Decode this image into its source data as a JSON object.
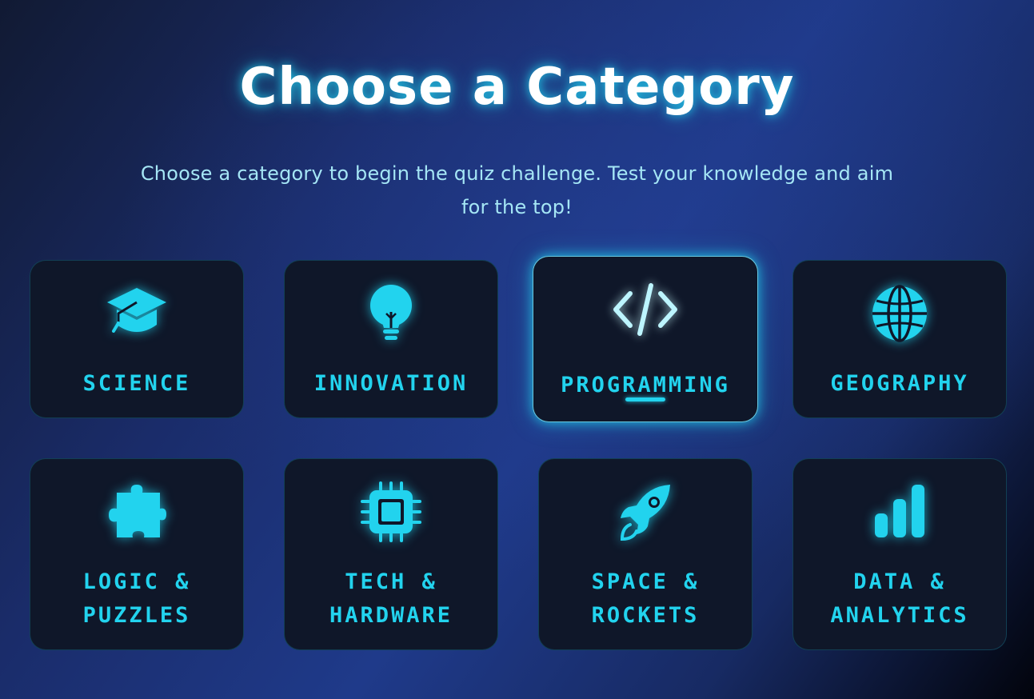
{
  "header": {
    "title": "Choose a Category",
    "subtitle": "Choose a category to begin the quiz challenge. Test your knowledge and aim for the top!"
  },
  "colors": {
    "accent": "#22d3ee",
    "card_bg": "#0f1729",
    "title": "#ffffff",
    "subtitle": "#a5e6f5"
  },
  "categories": [
    {
      "label": "SCIENCE",
      "icon": "graduation-cap-icon"
    },
    {
      "label": "INNOVATION",
      "icon": "lightbulb-icon"
    },
    {
      "label": "PROGRAMMING",
      "icon": "code-icon",
      "selected": true
    },
    {
      "label": "GEOGRAPHY",
      "icon": "globe-icon"
    },
    {
      "label": "LOGIC & PUZZLES",
      "icon": "puzzle-icon"
    },
    {
      "label": "TECH & HARDWARE",
      "icon": "chip-icon"
    },
    {
      "label": "SPACE & ROCKETS",
      "icon": "rocket-icon"
    },
    {
      "label": "DATA & ANALYTICS",
      "icon": "bar-chart-icon"
    }
  ]
}
